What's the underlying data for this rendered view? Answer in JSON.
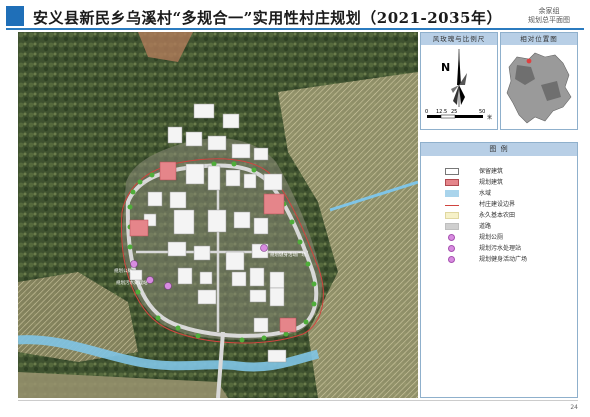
{
  "header": {
    "title": "安义县新民乡乌溪村“多规合一”实用性村庄规划（2021-2035年）",
    "sub_line1": "余家组",
    "sub_line2": "规划总平面图"
  },
  "compass_panel": {
    "title": "风玫瑰与比例尺",
    "north": "N",
    "scale_ticks": [
      "0",
      "12.5",
      "25",
      "50"
    ],
    "scale_unit": "米"
  },
  "location_panel": {
    "title": "相对位置图"
  },
  "legend": {
    "title": "图  例",
    "items": [
      {
        "label": "保留建筑",
        "fill": "#ffffff",
        "border": "#777777",
        "style": "box"
      },
      {
        "label": "规划建筑",
        "fill": "#e5858a",
        "border": "#b04a50",
        "style": "box"
      },
      {
        "label": "水域",
        "fill": "#a9d4ec",
        "border": "#a9d4ec",
        "style": "box"
      },
      {
        "label": "村庄建设边界",
        "fill": "#ffffff",
        "border": "#d0443f",
        "style": "line"
      },
      {
        "label": "永久基本农田",
        "fill": "#f6f1c8",
        "border": "#e0d7a0",
        "style": "box"
      },
      {
        "label": "道路",
        "fill": "#cfcfcf",
        "border": "#bfbfbf",
        "style": "box"
      },
      {
        "label": "规划公厕",
        "fill": "#d88ce0",
        "border": "#a650b0",
        "style": "dot"
      },
      {
        "label": "规划污水处理站",
        "fill": "#d88ce0",
        "border": "#a650b0",
        "style": "dot"
      },
      {
        "label": "规划健身活动广场",
        "fill": "#d88ce0",
        "border": "#a650b0",
        "style": "dot"
      }
    ]
  },
  "map": {
    "labels": [
      "规划健身活动广场",
      "规划公厕",
      "规划污水处理站"
    ]
  },
  "page_number": "24"
}
